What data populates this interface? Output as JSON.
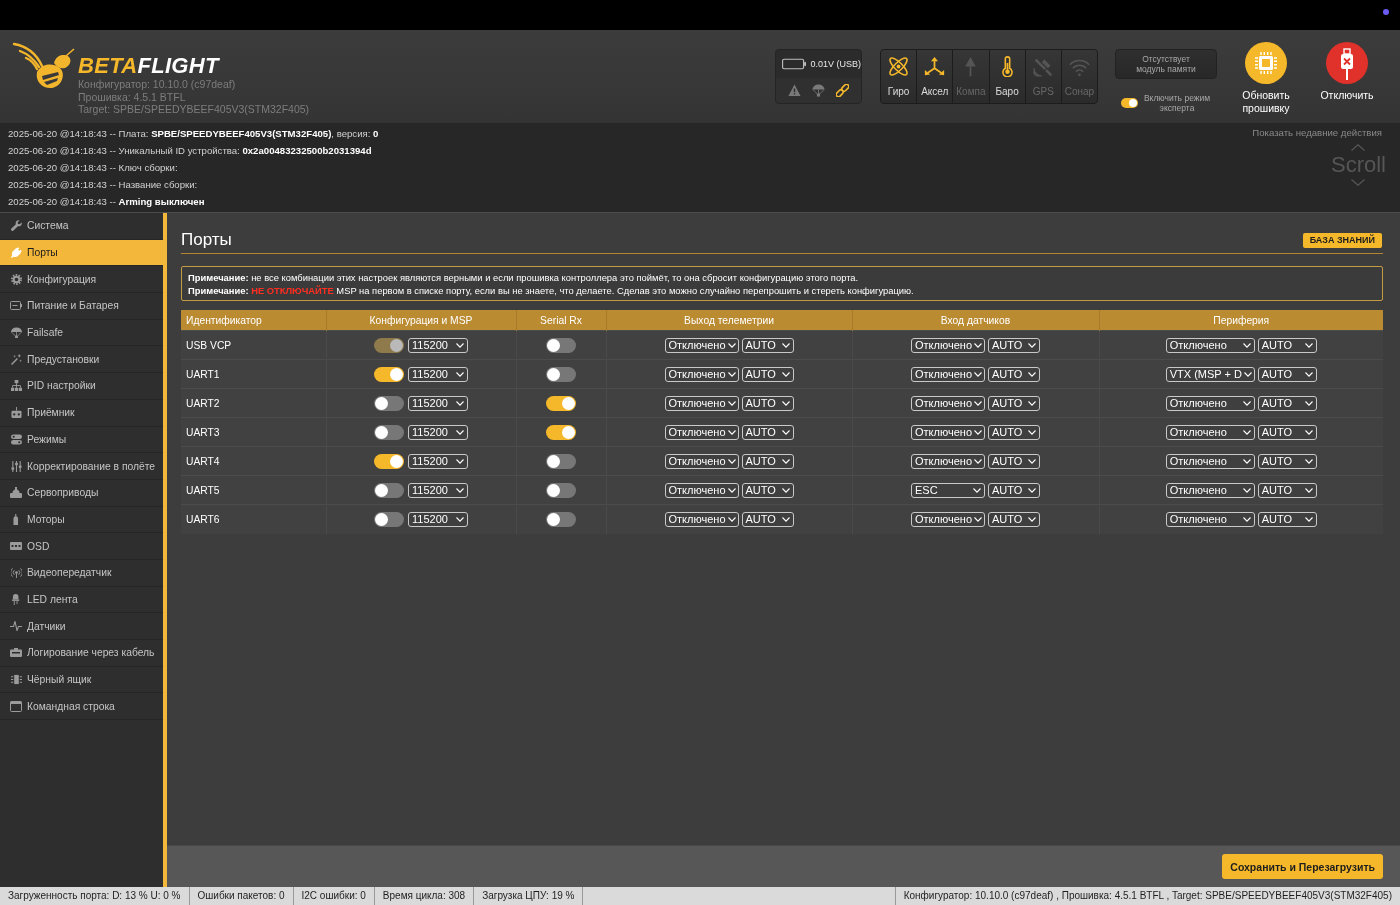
{
  "header": {
    "logo": {
      "parts": [
        "BETA",
        "FLIGHT"
      ]
    },
    "versions": [
      "Конфигуратор: 10.10.0 (c97deaf)",
      "Прошивка: 4.5.1 BTFL",
      "Target: SPBE/SPEEDYBEEF405V3(STM32F405)"
    ],
    "battery": {
      "reading": "0.01V (USB)",
      "indicators": [
        {
          "active": false
        },
        {
          "active": false
        },
        {
          "active": true
        }
      ]
    },
    "sensors": [
      {
        "label": "Гиро",
        "active": true
      },
      {
        "label": "Аксел",
        "active": true
      },
      {
        "label": "Компа",
        "active": false
      },
      {
        "label": "Баро",
        "active": true
      },
      {
        "label": "GPS",
        "active": false
      },
      {
        "label": "Сонар",
        "active": false
      }
    ],
    "memory_button": "Отсутствует модуль памяти",
    "expert_mode": {
      "label": "Включить режим эксперта",
      "on": true
    },
    "actions": [
      {
        "label": "Обновить прошивку",
        "kind": "update"
      },
      {
        "label": "Отключить",
        "kind": "disconnect"
      }
    ]
  },
  "log": {
    "lines": [
      "2025-06-20 @14:18:43 -- Плата: **SPBE/SPEEDYBEEF405V3(STM32F405)**, версия: **0**",
      "2025-06-20 @14:18:43 -- Уникальный ID устройства: **0x2a00483232500b2031394d**",
      "2025-06-20 @14:18:43 -- Ключ сборки:",
      "2025-06-20 @14:18:43 -- Название сборки:",
      "2025-06-20 @14:18:43 -- **Arming выключен**"
    ],
    "recent_link": "Показать недавние действия",
    "scroll_label": "Scroll"
  },
  "sidebar": {
    "items": [
      {
        "label": "Система",
        "selected": false
      },
      {
        "label": "Порты",
        "selected": true
      },
      {
        "label": "Конфигурация",
        "selected": false
      },
      {
        "label": "Питание и Батарея",
        "selected": false
      },
      {
        "label": "Failsafe",
        "selected": false
      },
      {
        "label": "Предустановки",
        "selected": false
      },
      {
        "label": "PID настройки",
        "selected": false
      },
      {
        "label": "Приёмник",
        "selected": false
      },
      {
        "label": "Режимы",
        "selected": false
      },
      {
        "label": "Корректирование в полёте",
        "selected": false
      },
      {
        "label": "Сервоприводы",
        "selected": false
      },
      {
        "label": "Моторы",
        "selected": false
      },
      {
        "label": "OSD",
        "selected": false
      },
      {
        "label": "Видеопередатчик",
        "selected": false
      },
      {
        "label": "LED лента",
        "selected": false
      },
      {
        "label": "Датчики",
        "selected": false
      },
      {
        "label": "Логирование через кабель",
        "selected": false
      },
      {
        "label": "Чёрный ящик",
        "selected": false
      },
      {
        "label": "Командная строка",
        "selected": false
      }
    ]
  },
  "ports": {
    "title": "Порты",
    "wiki_button": "БАЗА ЗНАНИЙ",
    "notes": [
      [
        {
          "kind": "label",
          "text": "Примечание:"
        },
        {
          "kind": "plain",
          "text": "не все комбинации этих настроек являются верными и если прошивка контроллера это поймёт, то она сбросит конфигурацию этого порта."
        }
      ],
      [
        {
          "kind": "label",
          "text": "Примечание:"
        },
        {
          "kind": "alert",
          "text": "НЕ ОТКЛЮЧАЙТЕ"
        },
        {
          "kind": "plain",
          "text": "MSP на первом в списке порту, если вы не знаете, что делаете. Сделав это можно случайно перепрошить и стереть конфигурацию."
        }
      ]
    ],
    "columns": [
      "Идентификатор",
      "Конфигурация и MSP",
      "Serial Rx",
      "Выход телеметрии",
      "Вход датчиков",
      "Периферия"
    ],
    "rows": [
      {
        "identifier": "USB VCP",
        "msp_on": true,
        "msp_disabled": true,
        "msp_baud": "115200",
        "serial_rx": false,
        "telemetry": {
          "protocol": "Отключено",
          "baud": "AUTO"
        },
        "sensors": {
          "protocol": "Отключено",
          "baud": "AUTO"
        },
        "peripherals": {
          "protocol": "Отключено",
          "baud": "AUTO"
        }
      },
      {
        "identifier": "UART1",
        "msp_on": true,
        "msp_disabled": false,
        "msp_baud": "115200",
        "serial_rx": false,
        "telemetry": {
          "protocol": "Отключено",
          "baud": "AUTO"
        },
        "sensors": {
          "protocol": "Отключено",
          "baud": "AUTO"
        },
        "peripherals": {
          "protocol": "VTX (MSP + D",
          "baud": "AUTO"
        }
      },
      {
        "identifier": "UART2",
        "msp_on": false,
        "msp_disabled": false,
        "msp_baud": "115200",
        "serial_rx": true,
        "telemetry": {
          "protocol": "Отключено",
          "baud": "AUTO"
        },
        "sensors": {
          "protocol": "Отключено",
          "baud": "AUTO"
        },
        "peripherals": {
          "protocol": "Отключено",
          "baud": "AUTO"
        }
      },
      {
        "identifier": "UART3",
        "msp_on": false,
        "msp_disabled": false,
        "msp_baud": "115200",
        "serial_rx": true,
        "telemetry": {
          "protocol": "Отключено",
          "baud": "AUTO"
        },
        "sensors": {
          "protocol": "Отключено",
          "baud": "AUTO"
        },
        "peripherals": {
          "protocol": "Отключено",
          "baud": "AUTO"
        }
      },
      {
        "identifier": "UART4",
        "msp_on": true,
        "msp_disabled": false,
        "msp_baud": "115200",
        "serial_rx": false,
        "telemetry": {
          "protocol": "Отключено",
          "baud": "AUTO"
        },
        "sensors": {
          "protocol": "Отключено",
          "baud": "AUTO"
        },
        "peripherals": {
          "protocol": "Отключено",
          "baud": "AUTO"
        }
      },
      {
        "identifier": "UART5",
        "msp_on": false,
        "msp_disabled": false,
        "msp_baud": "115200",
        "serial_rx": false,
        "telemetry": {
          "protocol": "Отключено",
          "baud": "AUTO"
        },
        "sensors": {
          "protocol": "ESC",
          "baud": "AUTO"
        },
        "peripherals": {
          "protocol": "Отключено",
          "baud": "AUTO"
        }
      },
      {
        "identifier": "UART6",
        "msp_on": false,
        "msp_disabled": false,
        "msp_baud": "115200",
        "serial_rx": false,
        "telemetry": {
          "protocol": "Отключено",
          "baud": "AUTO"
        },
        "sensors": {
          "protocol": "Отключено",
          "baud": "AUTO"
        },
        "peripherals": {
          "protocol": "Отключено",
          "baud": "AUTO"
        }
      }
    ]
  },
  "footer": {
    "save_button": "Сохранить и Перезагрузить"
  },
  "status_bar": {
    "items": [
      "Загруженность порта: D: 13 % U: 0 %",
      "Ошибки пакетов: 0",
      "I2C ошибки: 0",
      "Время цикла: 308",
      "Загрузка ЦПУ: 19 %"
    ],
    "version": "Конфигуратор: 10.10.0 (c97deaf) , Прошивка: 4.5.1 BTFL , Target: SPBE/SPEEDYBEEF405V3(STM32F405)"
  }
}
